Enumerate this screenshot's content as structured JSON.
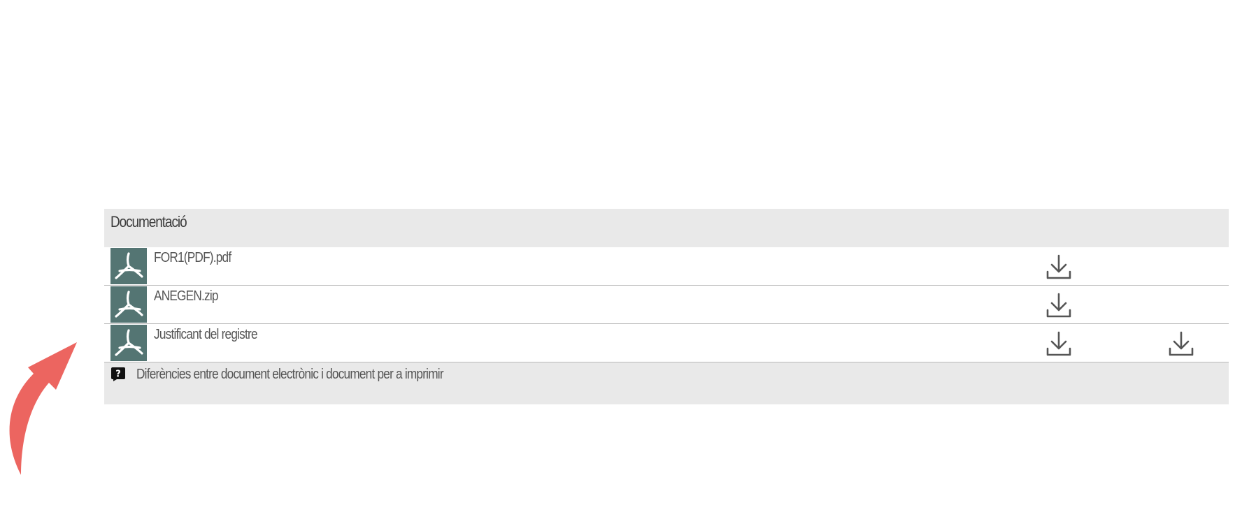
{
  "colors": {
    "panel_bg": "#e9e9e9",
    "row_bg": "#ffffff",
    "pdf_icon_bg": "#547573",
    "arrow": "#ec6560",
    "text": "#555555"
  },
  "panel": {
    "title": "Documentació",
    "rows": [
      {
        "name": "FOR1(PDF).pdf",
        "icon": "pdf-icon",
        "downloads": [
          "download-icon"
        ]
      },
      {
        "name": "ANEGEN.zip",
        "icon": "pdf-icon",
        "downloads": [
          "download-icon"
        ]
      },
      {
        "name": "Justificant del registre",
        "icon": "pdf-icon",
        "downloads": [
          "download-icon",
          "download-icon"
        ]
      }
    ],
    "help": {
      "icon": "question-icon",
      "text": "Diferències entre document electrònic i document per a imprimir"
    }
  },
  "annotation": {
    "icon": "curved-arrow-icon"
  }
}
